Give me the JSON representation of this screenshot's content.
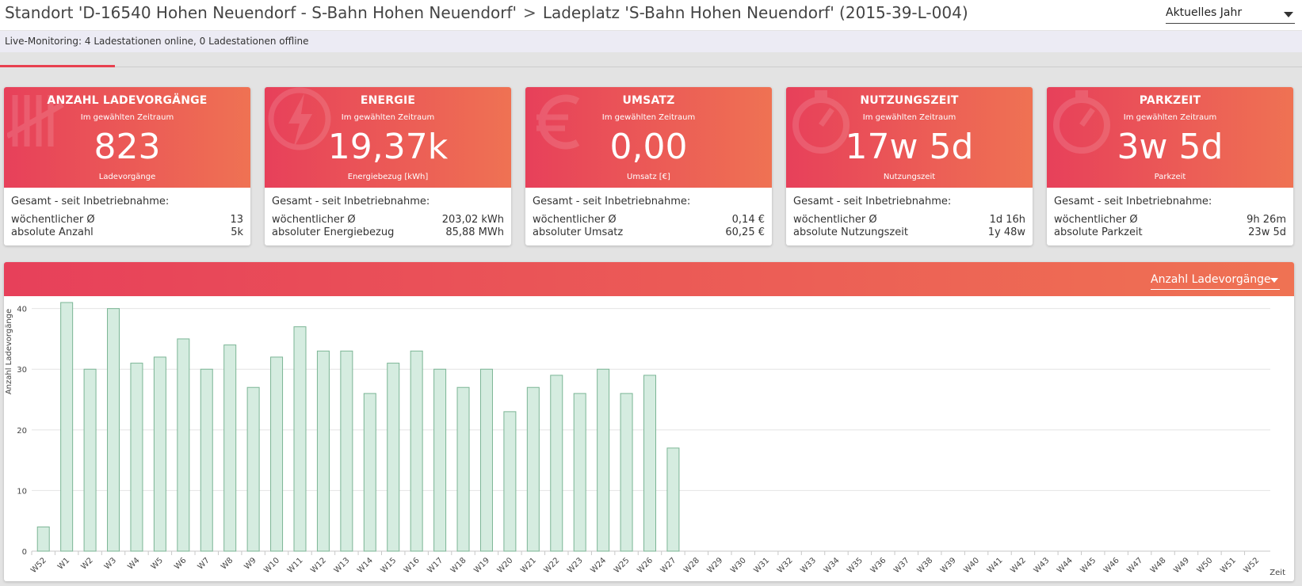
{
  "header": {
    "breadcrumb_site": "Standort 'D-16540 Hohen Neuendorf - S-Bahn Hohen Neuendorf'",
    "breadcrumb_sep": ">",
    "breadcrumb_station": "Ladeplatz 'S-Bahn Hohen Neuendorf' (2015-39-L-004)",
    "period_select": "Aktuelles Jahr"
  },
  "live_monitoring": "Live-Monitoring: 4 Ladestationen online, 0 Ladestationen offline",
  "cards": [
    {
      "title": "ANZAHL LADEVORGÄNGE",
      "subtitle": "Im gewählten Zeitraum",
      "value": "823",
      "unit": "Ladevorgänge",
      "total_label": "Gesamt - seit Inbetriebnahme:",
      "row1_label": "wöchentlicher Ø",
      "row1_value": "13",
      "row2_label": "absolute Anzahl",
      "row2_value": "5k",
      "icon": "tally-icon"
    },
    {
      "title": "ENERGIE",
      "subtitle": "Im gewählten Zeitraum",
      "value": "19,37k",
      "unit": "Energiebezug [kWh]",
      "total_label": "Gesamt - seit Inbetriebnahme:",
      "row1_label": "wöchentlicher Ø",
      "row1_value": "203,02 kWh",
      "row2_label": "absoluter Energiebezug",
      "row2_value": "85,88 MWh",
      "icon": "lightning-icon"
    },
    {
      "title": "UMSATZ",
      "subtitle": "Im gewählten Zeitraum",
      "value": "0,00",
      "unit": "Umsatz [€]",
      "total_label": "Gesamt - seit Inbetriebnahme:",
      "row1_label": "wöchentlicher Ø",
      "row1_value": "0,14 €",
      "row2_label": "absoluter Umsatz",
      "row2_value": "60,25 €",
      "icon": "euro-icon"
    },
    {
      "title": "NUTZUNGSZEIT",
      "subtitle": "Im gewählten Zeitraum",
      "value": "17w 5d",
      "unit": "Nutzungszeit",
      "total_label": "Gesamt - seit Inbetriebnahme:",
      "row1_label": "wöchentlicher Ø",
      "row1_value": "1d 16h",
      "row2_label": "absolute Nutzungszeit",
      "row2_value": "1y 48w",
      "icon": "stopwatch-icon"
    },
    {
      "title": "PARKZEIT",
      "subtitle": "Im gewählten Zeitraum",
      "value": "3w 5d",
      "unit": "Parkzeit",
      "total_label": "Gesamt - seit Inbetriebnahme:",
      "row1_label": "wöchentlicher Ø",
      "row1_value": "9h 26m",
      "row2_label": "absolute Parkzeit",
      "row2_value": "23w 5d",
      "icon": "stopwatch-icon"
    }
  ],
  "chart_panel": {
    "metric_select": "Anzahl Ladevorgänge"
  },
  "colors": {
    "accent_start": "#e7405a",
    "accent_end": "#ef7253",
    "bar_fill": "#d5ece0",
    "bar_stroke": "#7bb595"
  },
  "chart_data": {
    "type": "bar",
    "xlabel": "Zeit",
    "ylabel": "Anzahl Ladevorgänge",
    "ylim": [
      0,
      41
    ],
    "yticks": [
      0,
      10,
      20,
      30,
      40
    ],
    "grid": true,
    "categories": [
      "W52",
      "W1",
      "W2",
      "W3",
      "W4",
      "W5",
      "W6",
      "W7",
      "W8",
      "W9",
      "W10",
      "W11",
      "W12",
      "W13",
      "W14",
      "W15",
      "W16",
      "W17",
      "W18",
      "W19",
      "W20",
      "W21",
      "W22",
      "W23",
      "W24",
      "W25",
      "W26",
      "W27",
      "W28",
      "W29",
      "W30",
      "W31",
      "W32",
      "W33",
      "W34",
      "W35",
      "W36",
      "W37",
      "W38",
      "W39",
      "W40",
      "W41",
      "W42",
      "W43",
      "W44",
      "W45",
      "W46",
      "W47",
      "W48",
      "W49",
      "W50",
      "W51",
      "W52"
    ],
    "values": [
      4,
      41,
      30,
      40,
      31,
      32,
      35,
      30,
      34,
      27,
      32,
      37,
      33,
      33,
      26,
      31,
      33,
      30,
      27,
      30,
      23,
      27,
      29,
      26,
      30,
      26,
      29,
      17,
      0,
      0,
      0,
      0,
      0,
      0,
      0,
      0,
      0,
      0,
      0,
      0,
      0,
      0,
      0,
      0,
      0,
      0,
      0,
      0,
      0,
      0,
      0,
      0,
      0
    ]
  }
}
